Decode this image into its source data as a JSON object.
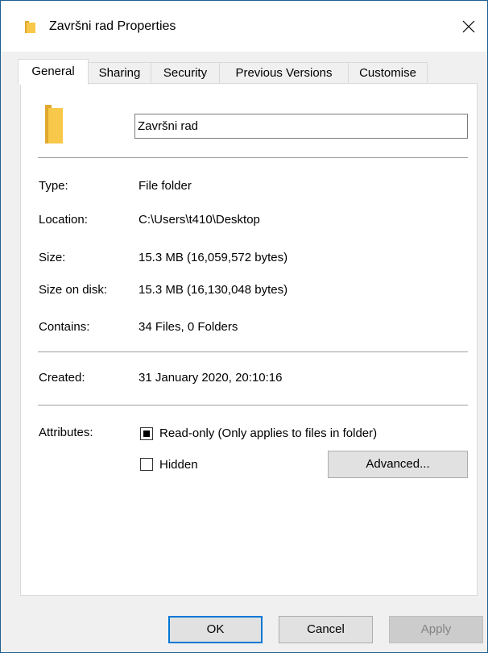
{
  "window": {
    "title": "Završni rad Properties",
    "close_glyph": "✕",
    "icons": {
      "title": "folder-icon",
      "close": "close-icon",
      "folder_large": "folder-icon"
    },
    "colors": {
      "folder_yellow": "#f8c84a",
      "folder_shade": "#e0a82e",
      "accent": "#0078d7"
    }
  },
  "tabs": [
    {
      "label": "General",
      "active": true
    },
    {
      "label": "Sharing",
      "active": false
    },
    {
      "label": "Security",
      "active": false
    },
    {
      "label": "Previous Versions",
      "active": false
    },
    {
      "label": "Customise",
      "active": false
    }
  ],
  "general": {
    "name_value": "Završni rad",
    "properties": [
      {
        "label": "Type:",
        "value": "File folder"
      },
      {
        "label": "Location:",
        "value": "C:\\Users\\t410\\Desktop"
      },
      {
        "label": "Size:",
        "value": "15.3 MB (16,059,572 bytes)"
      },
      {
        "label": "Size on disk:",
        "value": "15.3 MB (16,130,048 bytes)"
      },
      {
        "label": "Contains:",
        "value": "34 Files, 0 Folders"
      }
    ],
    "created": {
      "label": "Created:",
      "value": "31 January 2020, 20:10:16"
    },
    "attributes": {
      "label": "Attributes:",
      "readonly": {
        "label": "Read-only (Only applies to files in folder)",
        "state": "indeterminate"
      },
      "hidden": {
        "label": "Hidden",
        "state": "unchecked"
      },
      "advanced_button": "Advanced..."
    }
  },
  "footer": {
    "ok": "OK",
    "cancel": "Cancel",
    "apply": "Apply",
    "apply_enabled": false
  }
}
